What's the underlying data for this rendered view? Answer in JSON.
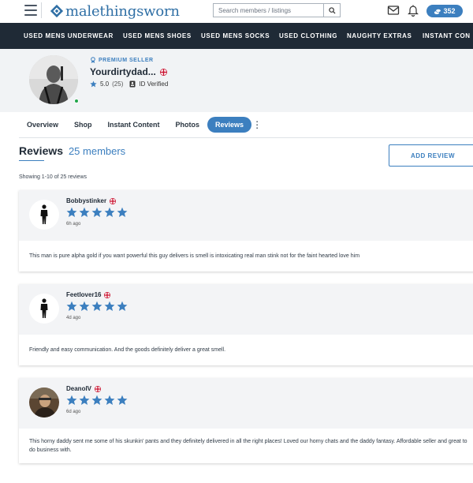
{
  "header": {
    "logo_text": "malethingsworn",
    "search_placeholder": "Search members / listings",
    "credits": "352"
  },
  "nav": {
    "items": [
      "USED MENS UNDERWEAR",
      "USED MENS SHOES",
      "USED MENS SOCKS",
      "USED CLOTHING",
      "NAUGHTY EXTRAS",
      "INSTANT CON"
    ]
  },
  "profile": {
    "badge": "PREMIUM SELLER",
    "name": "Yourdirtydad...",
    "rating": "5.0",
    "rating_count": "(25)",
    "verified": "ID Verified"
  },
  "tabs": [
    "Overview",
    "Shop",
    "Instant Content",
    "Photos",
    "Reviews"
  ],
  "reviews_header": {
    "title": "Reviews",
    "count": "25 members",
    "add_button": "ADD REVIEW",
    "showing": "Showing 1-10 of 25 reviews"
  },
  "reviews": [
    {
      "name": "Bobbystinker",
      "stars": 5,
      "time": "6h ago",
      "text": "This man is pure alpha gold if you want powerful this guy delivers is smell is intoxicating real man stink not for the faint hearted love him"
    },
    {
      "name": "Feetlover16",
      "stars": 5,
      "time": "4d ago",
      "text": "Friendly and easy communication. And the goods definitely deliver a great smell."
    },
    {
      "name": "DeanoIV",
      "stars": 5,
      "time": "6d ago",
      "text": "This horny daddy sent me some of his skunkin' pants and they definitely delivered in all the right places! Loved our horny chats and the daddy fantasy. Affordable seller and great to do business with."
    }
  ],
  "colors": {
    "accent": "#3c7fbf",
    "nav_bg": "#1f2a36",
    "star": "#3c7fbf",
    "online": "#22a64a"
  },
  "icons": {
    "menu": "hamburger-icon",
    "search": "search-icon",
    "mail": "mail-icon",
    "bell": "bell-icon",
    "premium": "rosette-icon",
    "verified": "id-card-icon",
    "flag": "uk-flag-icon",
    "star": "star-icon"
  }
}
